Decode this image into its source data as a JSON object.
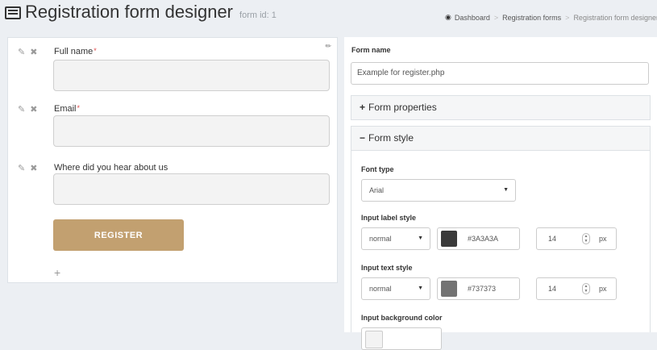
{
  "header": {
    "title": "Registration form designer",
    "form_id": "form id: 1",
    "title_icon": "list-alt-icon"
  },
  "breadcrumb": {
    "icon": "dashboard-icon",
    "items": [
      "Dashboard",
      "Registration forms",
      "Registration form designer"
    ]
  },
  "designer": {
    "pin_icon": "pin-icon",
    "tool_icons": [
      "edit-icon",
      "delete-icon"
    ],
    "fields": [
      {
        "label": "Full name",
        "required": true
      },
      {
        "label": "Email",
        "required": true
      },
      {
        "label": "Where did you hear about us",
        "required": false
      }
    ],
    "required_mark": "*",
    "register_label": "REGISTER",
    "add_field_icon": "plus-icon",
    "button_color": "#c2a070"
  },
  "settings": {
    "form_name_label": "Form name",
    "form_name_value": "Example for register.php",
    "sections": [
      {
        "sign": "+",
        "label": "Form properties",
        "expanded": false
      },
      {
        "sign": "−",
        "label": "Form style",
        "expanded": true
      }
    ],
    "font_type": {
      "label": "Font type",
      "value": "Arial"
    },
    "input_label_style": {
      "label": "Input label style",
      "weight": "normal",
      "color": "#3A3A3A",
      "size": "14",
      "unit": "px"
    },
    "input_text_style": {
      "label": "Input text style",
      "weight": "normal",
      "color": "#737373",
      "size": "14",
      "unit": "px"
    },
    "input_background_color": {
      "label": "Input background color"
    }
  }
}
